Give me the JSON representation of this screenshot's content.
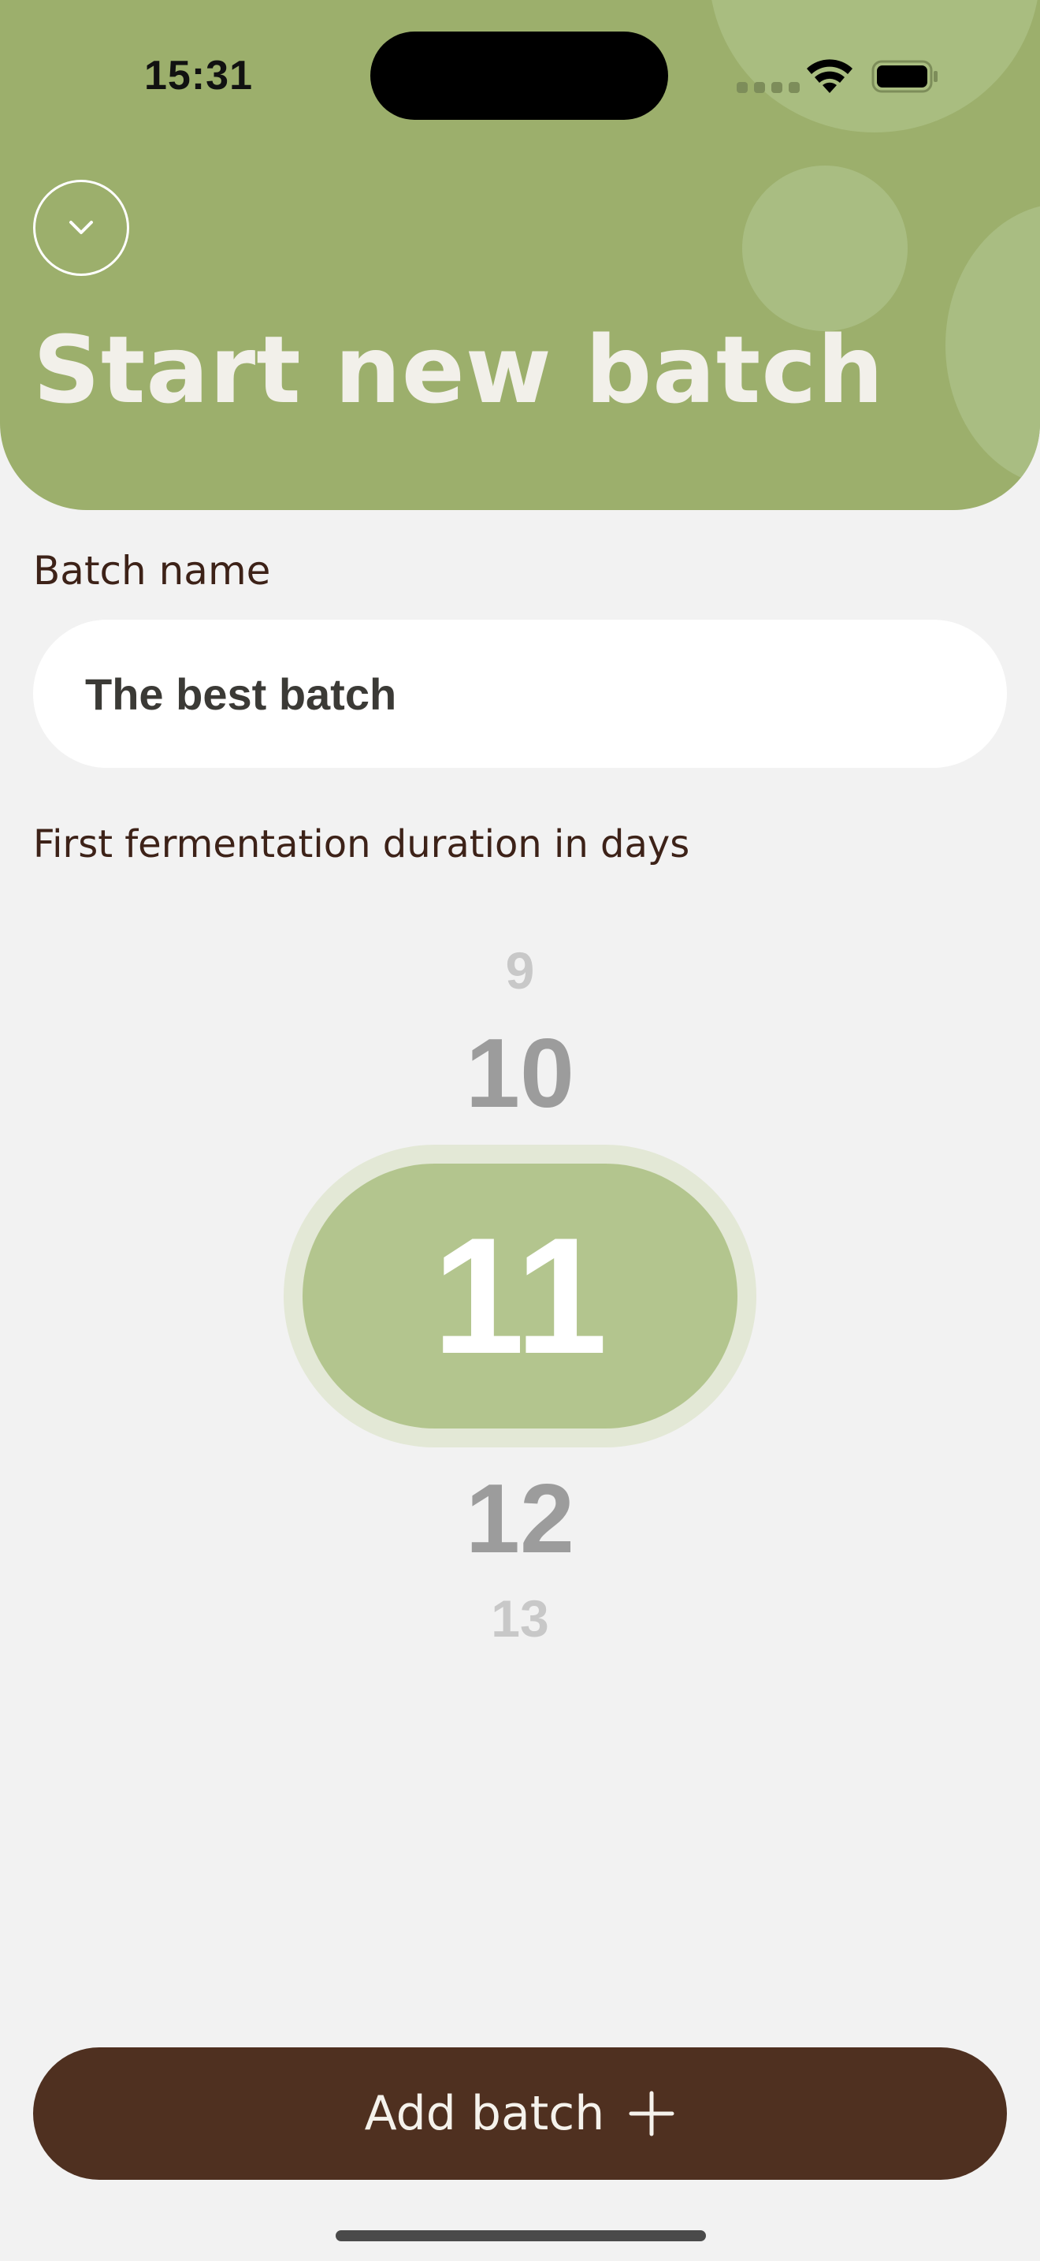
{
  "status_bar": {
    "time": "15:31",
    "icons": [
      "signal-icon",
      "wifi-icon",
      "battery-icon"
    ]
  },
  "header": {
    "back_icon": "chevron-down-icon",
    "title": "Start new batch",
    "background_color": "#9caf6c"
  },
  "form": {
    "batch_name_label": "Batch name",
    "batch_name_value": "The best batch",
    "duration_label": "First fermentation duration in days"
  },
  "duration_picker": {
    "values": [
      "9",
      "10",
      "11",
      "12",
      "13"
    ],
    "selected": "11",
    "selected_color": "#b3c58e"
  },
  "footer": {
    "add_button_label": "Add batch",
    "add_button_icon": "plus-icon",
    "button_color": "#4f3020"
  }
}
